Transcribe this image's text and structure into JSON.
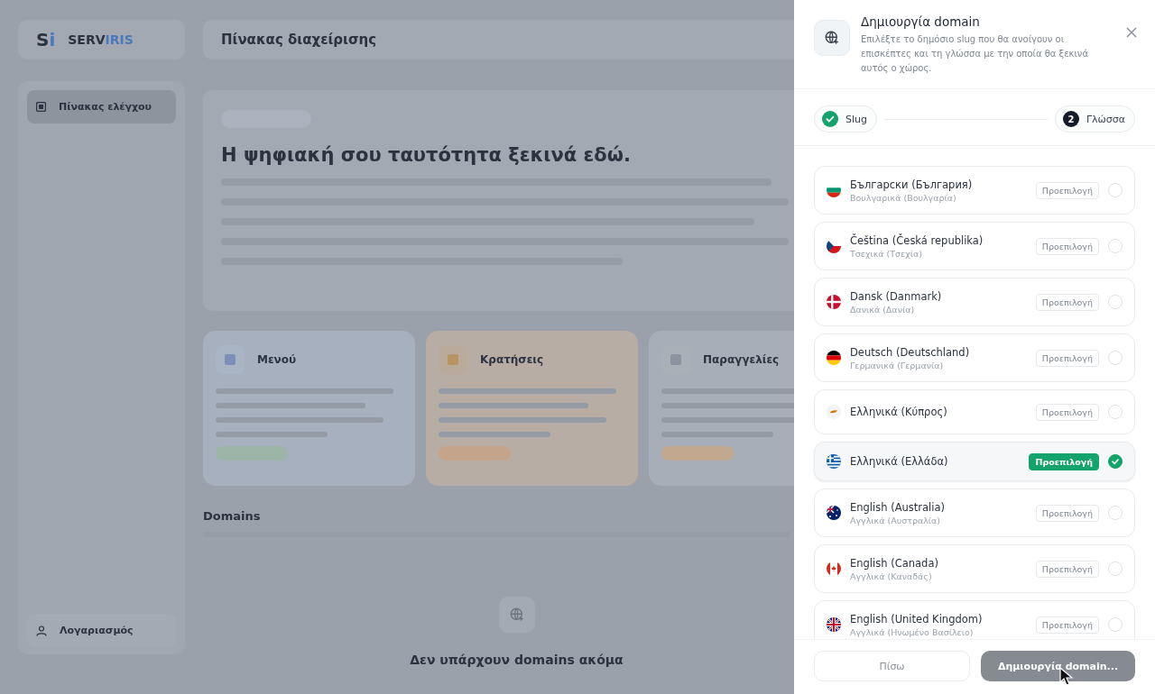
{
  "background": {
    "logo": {
      "mark_main": "S",
      "mark_accent": "i",
      "name_main": "SERV",
      "name_accent": "IRIS"
    },
    "header_title": "Πίνακας διαχείρισης",
    "sidebar": {
      "items": [
        {
          "label": "Πίνακας ελέγχου",
          "selected": true
        }
      ],
      "account": "Λογαριασμός"
    },
    "hero_title": "Η ψηφιακή σου ταυτότητα ξεκινά εδώ.",
    "feature_cards": [
      {
        "title": "Μενού",
        "kind": "blue"
      },
      {
        "title": "Κρατήσεις",
        "kind": "orange"
      },
      {
        "title": "Παραγγελίες",
        "kind": "grey"
      }
    ],
    "domains": {
      "title": "Domains",
      "empty_title": "Δεν υπάρχουν domains ακόμα"
    }
  },
  "panel": {
    "title": "Δημιουργία domain",
    "subtitle": "Επιλέξτε το δημόσιο slug που θα ανοίγουν οι επισκέπτες και τη γλώσσα με την οποία θα ξεκινά αυτός ο χώρος.",
    "steps": [
      {
        "label": "Slug",
        "done": true
      },
      {
        "label": "Γλώσσα",
        "number": "2",
        "done": false
      }
    ],
    "languages": [
      {
        "name": "Български (България)",
        "native": "Βουλγαρικά (Βουλγαρία)",
        "kind": "bg",
        "badge": "Προεπιλογή",
        "selected": false
      },
      {
        "name": "Čeština (Česká republika)",
        "native": "Τσεχικά (Τσεχία)",
        "kind": "cz",
        "badge": "Προεπιλογή",
        "selected": false
      },
      {
        "name": "Dansk (Danmark)",
        "native": "Δανικά (Δανία)",
        "kind": "dk",
        "badge": "Προεπιλογή",
        "selected": false
      },
      {
        "name": "Deutsch (Deutschland)",
        "native": "Γερμανικά (Γερμανία)",
        "kind": "de",
        "badge": "Προεπιλογή",
        "selected": false
      },
      {
        "name": "Ελληνικά (Κύπρος)",
        "kind": "cy",
        "badge": "Προεπιλογή",
        "selected": false
      },
      {
        "name": "Ελληνικά (Ελλάδα)",
        "kind": "gr",
        "badge": "Προεπιλογή",
        "selected": true
      },
      {
        "name": "English (Australia)",
        "native": "Αγγλικά (Αυστραλία)",
        "kind": "au",
        "badge": "Προεπιλογή",
        "selected": false
      },
      {
        "name": "English (Canada)",
        "native": "Αγγλικά (Καναδάς)",
        "kind": "ca",
        "badge": "Προεπιλογή",
        "selected": false
      },
      {
        "name": "English (United Kingdom)",
        "native": "Αγγλικά (Ηνωμένο Βασίλειο)",
        "kind": "gb",
        "badge": "Προεπιλογή",
        "selected": false
      }
    ],
    "back_button": "Πίσω",
    "submit_button": "Δημιουργία domain...",
    "submit_busy": true
  }
}
